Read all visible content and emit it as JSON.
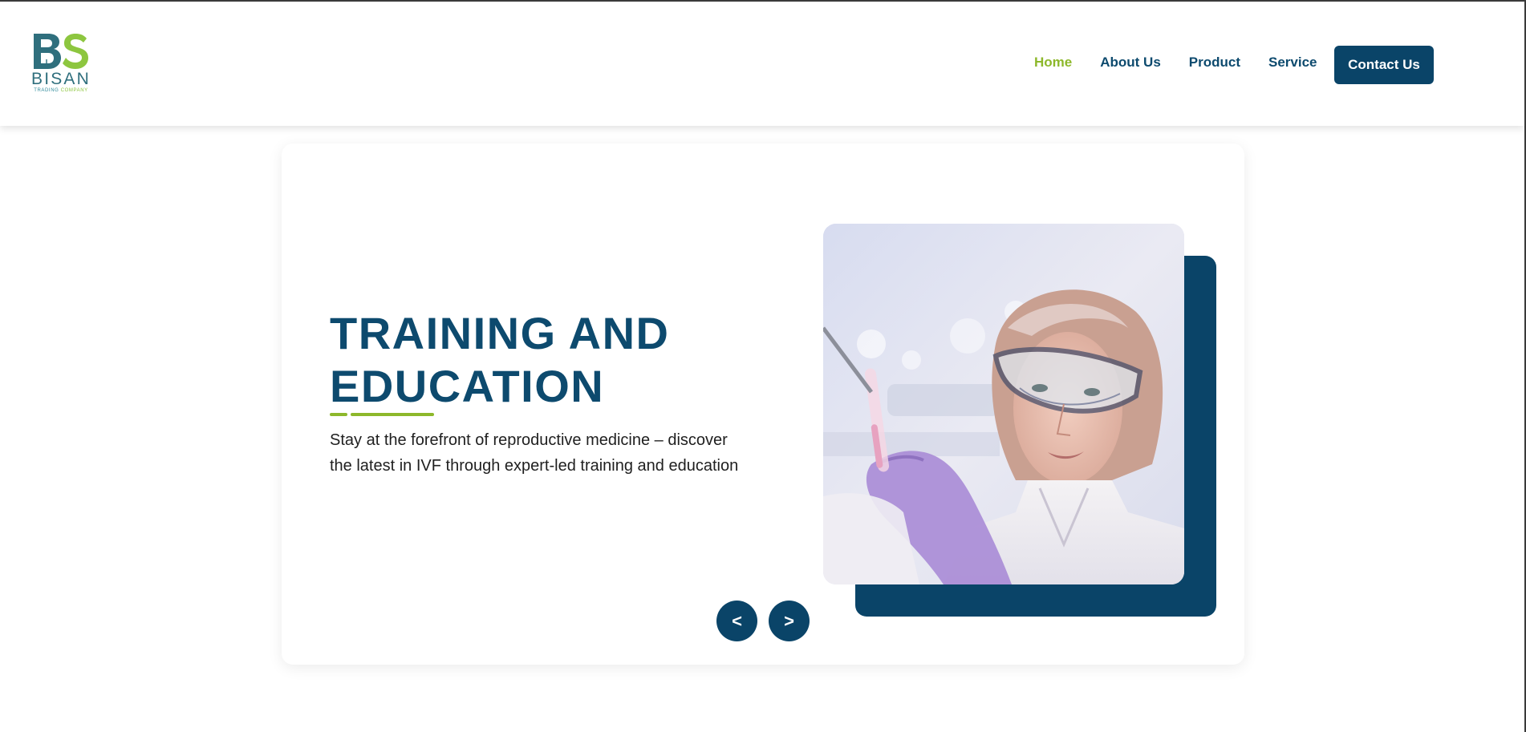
{
  "brand": {
    "name": "BISAN",
    "subtitle_part1": "TRADING",
    "subtitle_part2": "COMPANY",
    "logo_letters": "BS",
    "colors": {
      "teal": "#2f6f7d",
      "green": "#8dc63f"
    }
  },
  "nav": {
    "items": [
      {
        "label": "Home",
        "active": true
      },
      {
        "label": "About Us",
        "active": false
      },
      {
        "label": "Product",
        "active": false
      },
      {
        "label": "Service",
        "active": false
      }
    ],
    "contact_label": "Contact Us"
  },
  "hero": {
    "title_line1": "TRAINING AND",
    "title_line2": "EDUCATION",
    "description_line1": "Stay at the forefront of reproductive medicine – discover",
    "description_line2": "the latest in IVF through expert-led training and education",
    "image_icon": "lab-scientist-photo",
    "prev_label": "<",
    "next_label": ">"
  },
  "colors": {
    "primary": "#0a4468",
    "accent": "#8db82b",
    "text": "#1f1f1f",
    "background": "#ffffff"
  }
}
